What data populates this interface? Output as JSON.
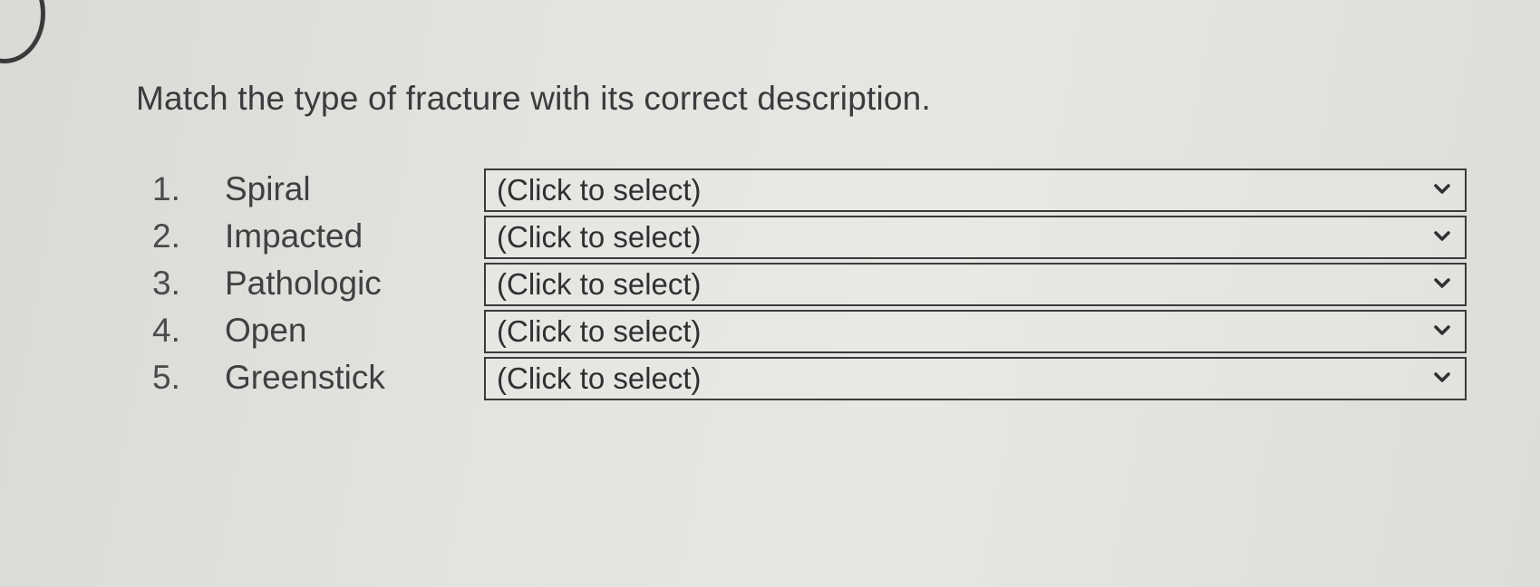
{
  "question": {
    "prompt": "Match the type of fracture with its correct description."
  },
  "items": [
    {
      "number": "1.",
      "term": "Spiral",
      "selected": "(Click to select)"
    },
    {
      "number": "2.",
      "term": "Impacted",
      "selected": "(Click to select)"
    },
    {
      "number": "3.",
      "term": "Pathologic",
      "selected": "(Click to select)"
    },
    {
      "number": "4.",
      "term": "Open",
      "selected": "(Click to select)"
    },
    {
      "number": "5.",
      "term": "Greenstick",
      "selected": "(Click to select)"
    }
  ],
  "icons": {
    "dropdown": "chevron-down-icon"
  },
  "colors": {
    "background": "#e2e3df",
    "text": "#3b3c3d",
    "border": "#3a3b3c"
  }
}
